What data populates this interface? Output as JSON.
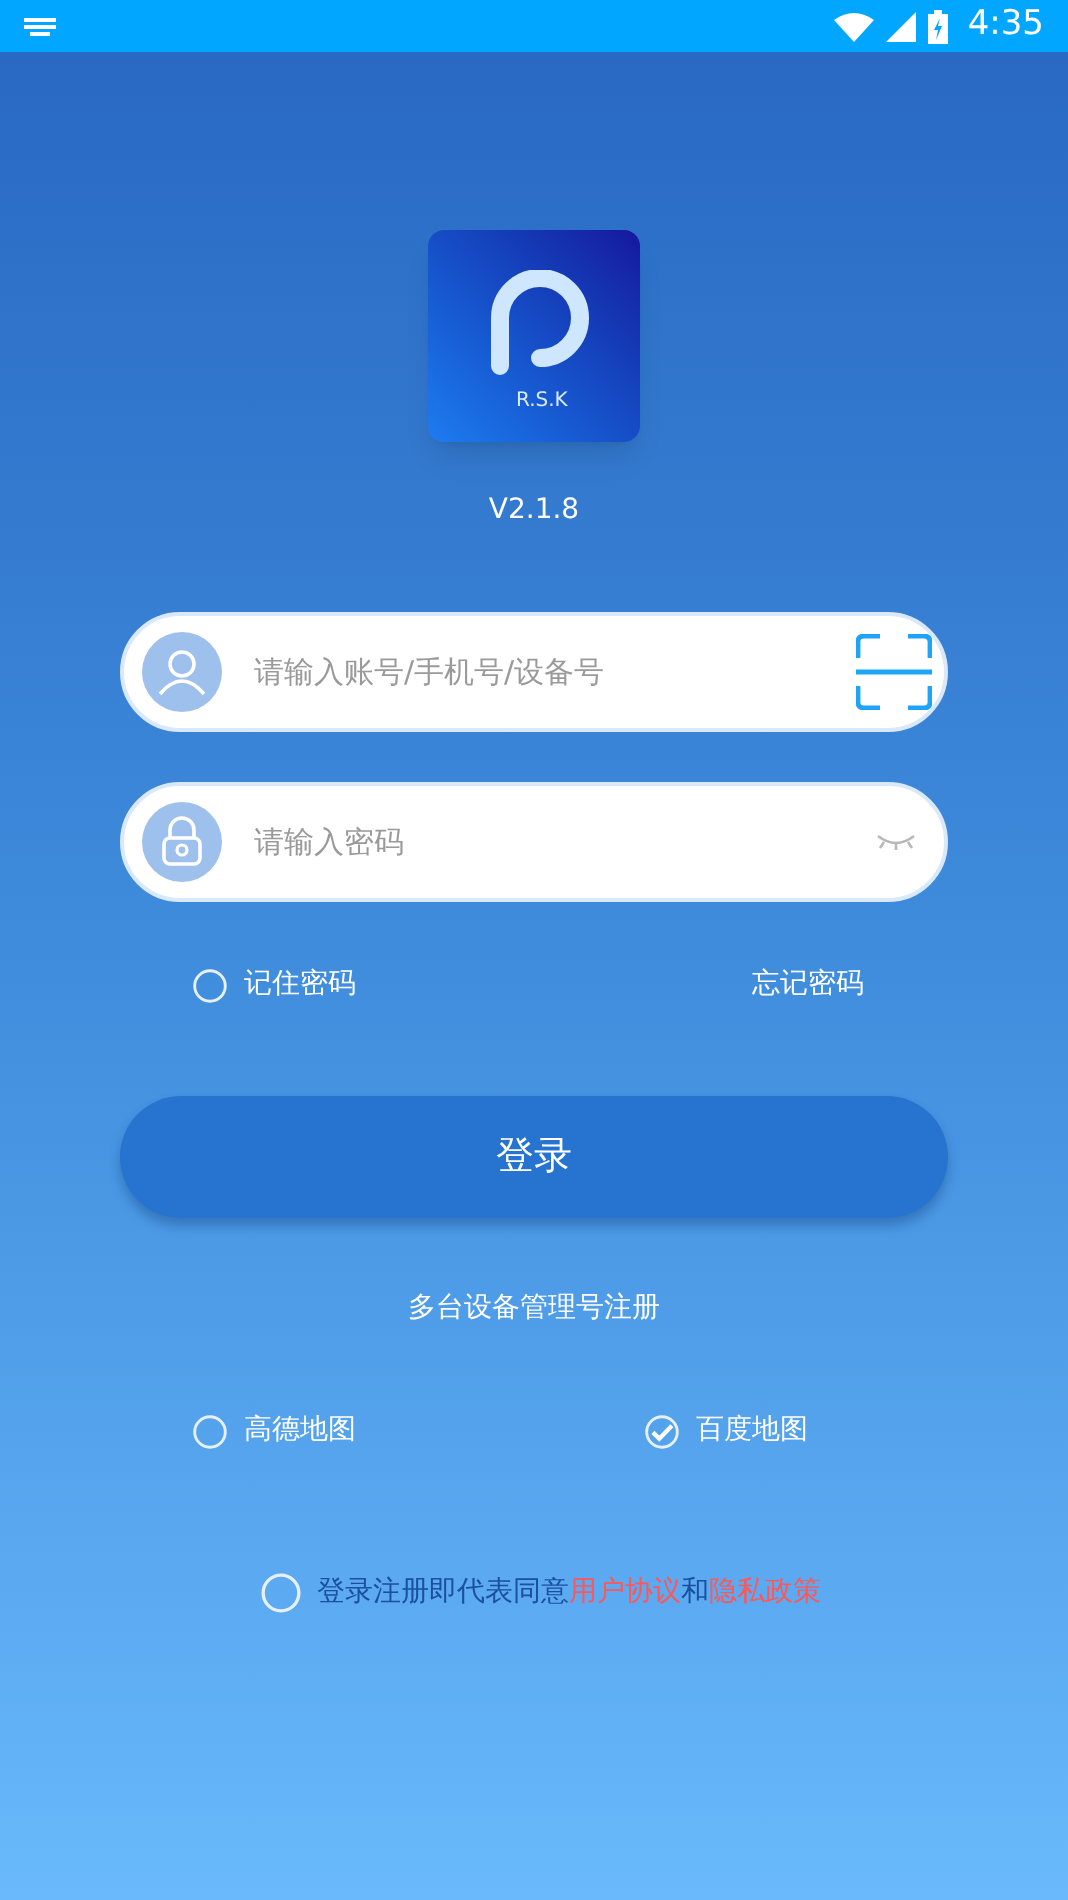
{
  "status_bar": {
    "time": "4:35"
  },
  "logo": {
    "text": "R.S.K"
  },
  "version": "V2.1.8",
  "account_field": {
    "placeholder": "请输入账号/手机号/设备号"
  },
  "password_field": {
    "placeholder": "请输入密码"
  },
  "remember_password": {
    "label": "记住密码",
    "checked": false
  },
  "forgot_password": "忘记密码",
  "login_button": "登录",
  "register_link": "多台设备管理号注册",
  "map_options": [
    {
      "label": "高德地图",
      "selected": false
    },
    {
      "label": "百度地图",
      "selected": true
    }
  ],
  "agreement": {
    "checked": false,
    "text": "登录注册即代表同意",
    "link_1": "用户协议",
    "joiner": "和",
    "link_2": "隐私政策"
  }
}
